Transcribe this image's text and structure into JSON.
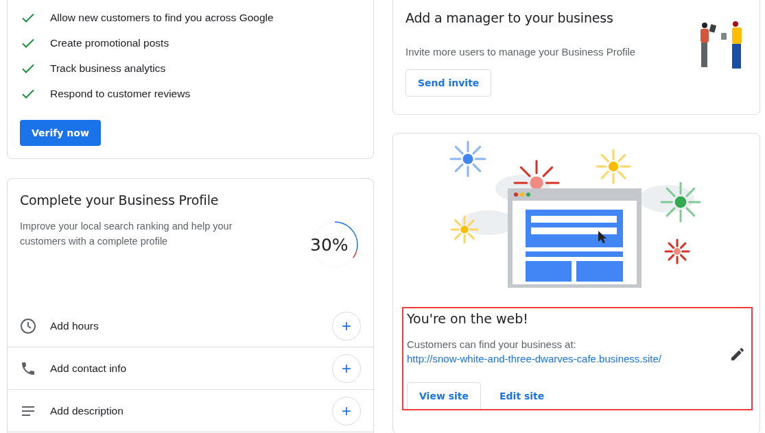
{
  "verify_card": {
    "benefits": [
      "Allow new customers to find you across Google",
      "Create promotional posts",
      "Track business analytics",
      "Respond to customer reviews"
    ],
    "button": "Verify now"
  },
  "profile_card": {
    "title": "Complete your Business Profile",
    "description": "Improve your local search ranking and help your customers with a complete profile",
    "progress": {
      "level": 0.3,
      "reading": "30%"
    },
    "items": [
      {
        "kind": "hours",
        "label": "Add hours",
        "action": "+"
      },
      {
        "kind": "contact",
        "label": "Add contact info",
        "action": "+"
      },
      {
        "kind": "description",
        "label": "Add description",
        "action": "+"
      }
    ]
  },
  "manager_card": {
    "title": "Add a manager to your business",
    "description": "Invite more users to manage your Business Profile",
    "button": "Send invite"
  },
  "website_card": {
    "highlighted": true,
    "title": "You're on the web!",
    "description": "Customers can find your business at:",
    "url": "http://snow-white-and-three-dwarves-cafe.business.site/",
    "buttons": [
      {
        "label": "View site",
        "kind": "outlined"
      },
      {
        "label": "Edit site",
        "kind": "text"
      }
    ]
  }
}
